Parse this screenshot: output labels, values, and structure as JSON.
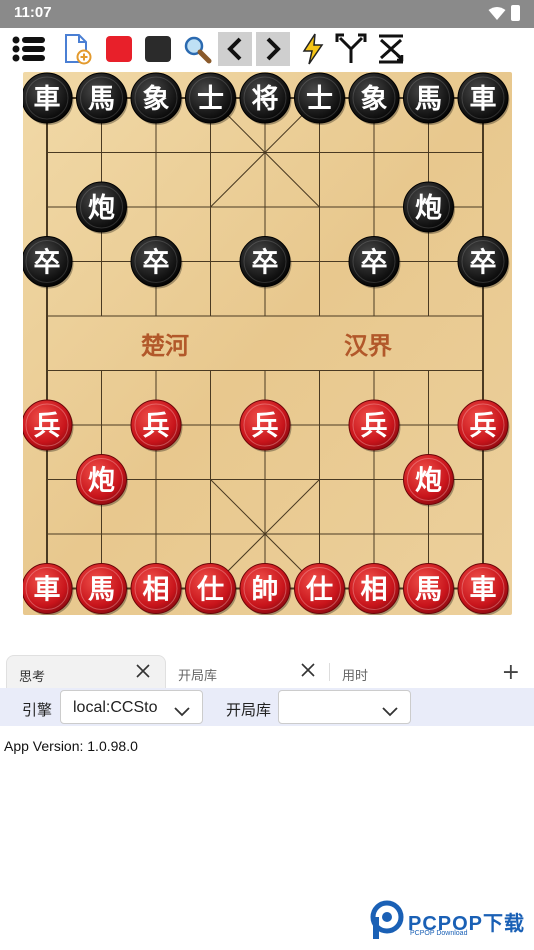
{
  "status_bar": {
    "time": "11:07"
  },
  "toolbar": {
    "icons": [
      "menu-list-icon",
      "new-document-icon",
      "red-square-icon",
      "black-square-icon",
      "magnifier-icon",
      "chevron-left-icon",
      "chevron-right-icon",
      "lightning-icon",
      "branch-icon",
      "flip-board-icon"
    ]
  },
  "board": {
    "river_left": "楚河",
    "river_right": "汉界",
    "pieces": [
      {
        "side": "black",
        "char": "車",
        "col": 0,
        "row": 0
      },
      {
        "side": "black",
        "char": "馬",
        "col": 1,
        "row": 0
      },
      {
        "side": "black",
        "char": "象",
        "col": 2,
        "row": 0
      },
      {
        "side": "black",
        "char": "士",
        "col": 3,
        "row": 0
      },
      {
        "side": "black",
        "char": "将",
        "col": 4,
        "row": 0
      },
      {
        "side": "black",
        "char": "士",
        "col": 5,
        "row": 0
      },
      {
        "side": "black",
        "char": "象",
        "col": 6,
        "row": 0
      },
      {
        "side": "black",
        "char": "馬",
        "col": 7,
        "row": 0
      },
      {
        "side": "black",
        "char": "車",
        "col": 8,
        "row": 0
      },
      {
        "side": "black",
        "char": "炮",
        "col": 1,
        "row": 2
      },
      {
        "side": "black",
        "char": "炮",
        "col": 7,
        "row": 2
      },
      {
        "side": "black",
        "char": "卒",
        "col": 0,
        "row": 3
      },
      {
        "side": "black",
        "char": "卒",
        "col": 2,
        "row": 3
      },
      {
        "side": "black",
        "char": "卒",
        "col": 4,
        "row": 3
      },
      {
        "side": "black",
        "char": "卒",
        "col": 6,
        "row": 3
      },
      {
        "side": "black",
        "char": "卒",
        "col": 8,
        "row": 3
      },
      {
        "side": "red",
        "char": "兵",
        "col": 0,
        "row": 6
      },
      {
        "side": "red",
        "char": "兵",
        "col": 2,
        "row": 6
      },
      {
        "side": "red",
        "char": "兵",
        "col": 4,
        "row": 6
      },
      {
        "side": "red",
        "char": "兵",
        "col": 6,
        "row": 6
      },
      {
        "side": "red",
        "char": "兵",
        "col": 8,
        "row": 6
      },
      {
        "side": "red",
        "char": "炮",
        "col": 1,
        "row": 7
      },
      {
        "side": "red",
        "char": "炮",
        "col": 7,
        "row": 7
      },
      {
        "side": "red",
        "char": "車",
        "col": 0,
        "row": 9
      },
      {
        "side": "red",
        "char": "馬",
        "col": 1,
        "row": 9
      },
      {
        "side": "red",
        "char": "相",
        "col": 2,
        "row": 9
      },
      {
        "side": "red",
        "char": "仕",
        "col": 3,
        "row": 9
      },
      {
        "side": "red",
        "char": "帥",
        "col": 4,
        "row": 9
      },
      {
        "side": "red",
        "char": "仕",
        "col": 5,
        "row": 9
      },
      {
        "side": "red",
        "char": "相",
        "col": 6,
        "row": 9
      },
      {
        "side": "red",
        "char": "馬",
        "col": 7,
        "row": 9
      },
      {
        "side": "red",
        "char": "車",
        "col": 8,
        "row": 9
      }
    ]
  },
  "tabs": [
    {
      "label": "思考",
      "active": true
    },
    {
      "label": "开局库",
      "active": false
    },
    {
      "label": "用时",
      "active": false
    }
  ],
  "engine_bar": {
    "engine_label": "引擎",
    "engine_value": "local:CCSto",
    "book_label": "开局库",
    "book_value": ""
  },
  "info": {
    "app_version": "App Version: 1.0.98.0"
  },
  "watermark": {
    "text": "PCPOP下载",
    "sub": "PCPOP Download"
  }
}
